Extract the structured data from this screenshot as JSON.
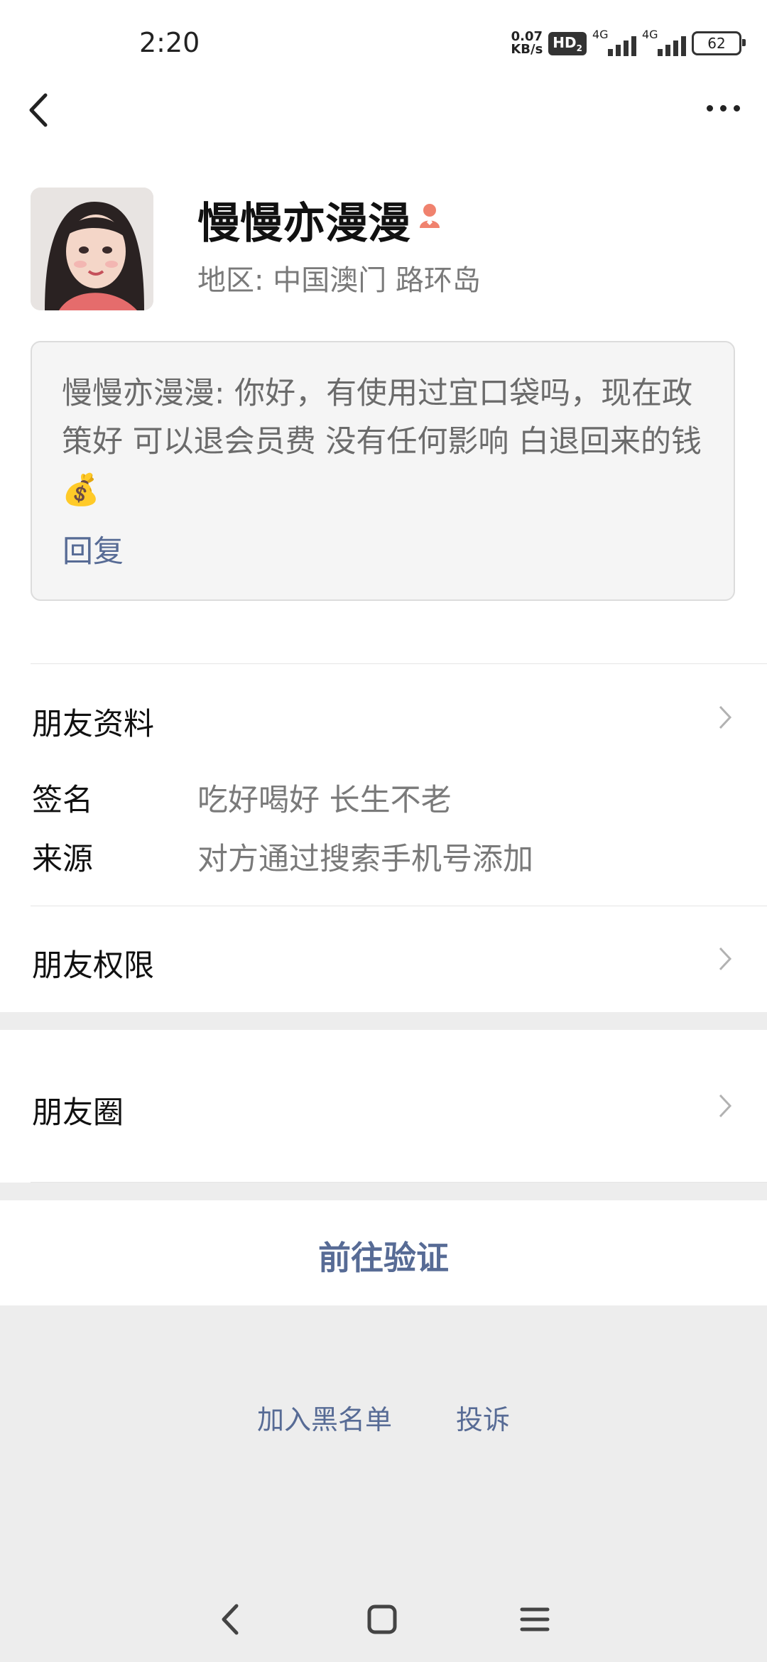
{
  "status_bar": {
    "time": "2:20",
    "net_speed_value": "0.07",
    "net_speed_unit": "KB/s",
    "hd_badge": "HD",
    "hd_sub": "2",
    "sig1_label": "4G",
    "sig2_label": "4G",
    "battery": "62"
  },
  "header": {
    "back_icon": "chevron-left-icon",
    "more_icon": "more-dots-icon"
  },
  "profile": {
    "name": "慢慢亦漫漫",
    "gender_icon": "female-icon",
    "gender_color": "#f0826e",
    "region": "地区:  中国澳门  路环岛"
  },
  "message": {
    "text": "慢慢亦漫漫: 你好，有使用过宜口袋吗，现在政策好 可以退会员费 没有任何影响 白退回来的钱💰",
    "reply_label": "回复"
  },
  "friend_info": {
    "title": "朋友资料",
    "signature_label": "签名",
    "signature_value": "吃好喝好 长生不老",
    "source_label": "来源",
    "source_value": "对方通过搜索手机号添加"
  },
  "permissions": {
    "title": "朋友权限"
  },
  "moments": {
    "title": "朋友圈"
  },
  "actions": {
    "verify": "前往验证",
    "blacklist": "加入黑名单",
    "report": "投诉"
  },
  "colors": {
    "link": "#576b95",
    "background": "#ededed"
  }
}
